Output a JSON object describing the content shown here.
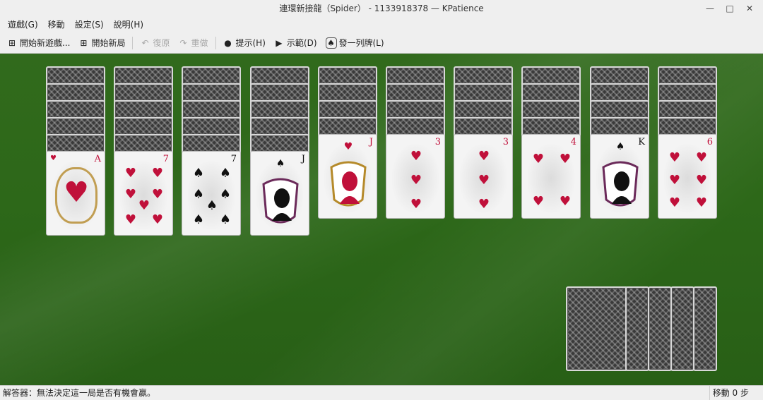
{
  "window": {
    "title": "連環新接龍（Spider） - 1133918378 — KPatience"
  },
  "menu": [
    {
      "id": "game",
      "label": "遊戲(G)"
    },
    {
      "id": "move",
      "label": "移動"
    },
    {
      "id": "settings",
      "label": "設定(S)"
    },
    {
      "id": "help",
      "label": "說明(H)"
    }
  ],
  "toolbar": {
    "new_game": "開始新遊戲...",
    "new_deal": "開始新局",
    "undo": "復原",
    "redo": "重做",
    "hint": "提示(H)",
    "demo": "示範(D)",
    "deal_row": "發一列牌(L)"
  },
  "tableau": [
    {
      "face_down": 5,
      "rank": "A",
      "suit": "♥",
      "color": "red"
    },
    {
      "face_down": 5,
      "rank": "7",
      "suit": "♥",
      "color": "red"
    },
    {
      "face_down": 5,
      "rank": "7",
      "suit": "♠",
      "color": "black"
    },
    {
      "face_down": 5,
      "rank": "J",
      "suit": "♠",
      "color": "black"
    },
    {
      "face_down": 4,
      "rank": "J",
      "suit": "♥",
      "color": "red"
    },
    {
      "face_down": 4,
      "rank": "3",
      "suit": "♥",
      "color": "red"
    },
    {
      "face_down": 4,
      "rank": "3",
      "suit": "♥",
      "color": "red"
    },
    {
      "face_down": 4,
      "rank": "4",
      "suit": "♥",
      "color": "red"
    },
    {
      "face_down": 4,
      "rank": "K",
      "suit": "♠",
      "color": "black"
    },
    {
      "face_down": 4,
      "rank": "6",
      "suit": "♥",
      "color": "red"
    }
  ],
  "stock": {
    "piles": 5
  },
  "status": {
    "message": "解答器：無法決定這一局是否有機會贏。",
    "moves": "移動 0 步"
  },
  "colors": {
    "felt": "#2d6819",
    "heart": "#c0103a",
    "spade": "#111111"
  }
}
